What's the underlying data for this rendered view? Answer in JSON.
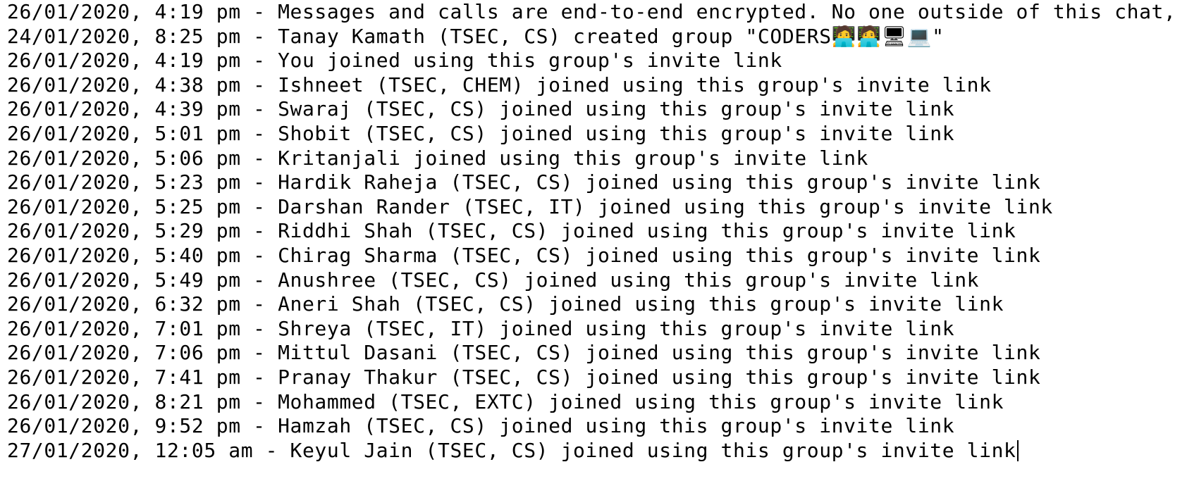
{
  "document": {
    "lines": [
      "26/01/2020, 4:19 pm - Messages and calls are end-to-end encrypted. No one outside of this chat, not even WhatsApp, can read or listen to them.",
      "24/01/2020, 8:25 pm - Tanay Kamath (TSEC, CS) created group \"CODERS🧑‍💻🧑‍💻🖥💻\"",
      "26/01/2020, 4:19 pm - You joined using this group's invite link",
      "26/01/2020, 4:38 pm - Ishneet (TSEC, CHEM) joined using this group's invite link",
      "26/01/2020, 4:39 pm - Swaraj (TSEC, CS) joined using this group's invite link",
      "26/01/2020, 5:01 pm - Shobit (TSEC, CS) joined using this group's invite link",
      "26/01/2020, 5:06 pm - Kritanjali joined using this group's invite link",
      "26/01/2020, 5:23 pm - Hardik Raheja (TSEC, CS) joined using this group's invite link",
      "26/01/2020, 5:25 pm - Darshan Rander (TSEC, IT) joined using this group's invite link",
      "26/01/2020, 5:29 pm - Riddhi Shah (TSEC, CS) joined using this group's invite link",
      "26/01/2020, 5:40 pm - Chirag Sharma (TSEC, CS) joined using this group's invite link",
      "26/01/2020, 5:49 pm - Anushree (TSEC, CS) joined using this group's invite link",
      "26/01/2020, 6:32 pm - Aneri Shah (TSEC, CS) joined using this group's invite link",
      "26/01/2020, 7:01 pm - Shreya (TSEC, IT) joined using this group's invite link",
      "26/01/2020, 7:06 pm - Mittul Dasani (TSEC, CS) joined using this group's invite link",
      "26/01/2020, 7:41 pm - Pranay Thakur (TSEC, CS) joined using this group's invite link",
      "26/01/2020, 8:21 pm - Mohammed (TSEC, EXTC) joined using this group's invite link",
      "26/01/2020, 9:52 pm - Hamzah (TSEC, CS) joined using this group's invite link",
      "27/01/2020, 12:05 am - Keyul Jain (TSEC, CS) joined using this group's invite link"
    ]
  }
}
